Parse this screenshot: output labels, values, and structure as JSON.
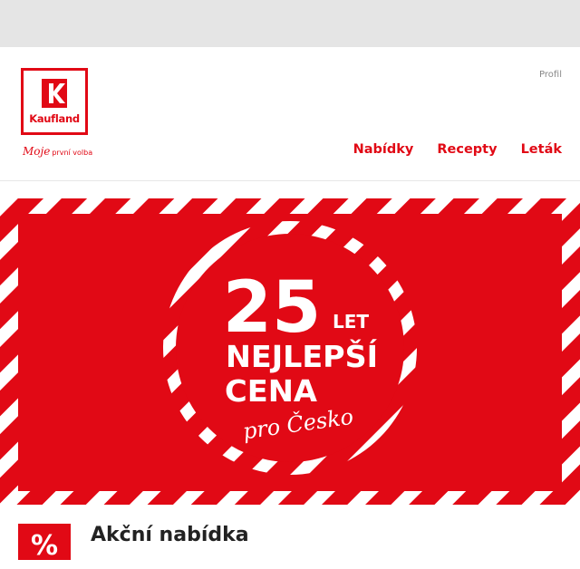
{
  "brand": {
    "name": "Kaufland",
    "slogan_script": "Moje",
    "slogan_rest": "první volba",
    "color": "#e10915"
  },
  "header": {
    "profile_label": "Profil",
    "nav": [
      {
        "label": "Nabídky"
      },
      {
        "label": "Recepty"
      },
      {
        "label": "Leták"
      }
    ]
  },
  "banner": {
    "number": "25",
    "let": "LET",
    "line1": "NEJLEPŠÍ",
    "line2": "CENA",
    "script": "pro Česko",
    "stripe_colors": [
      "#e10915",
      "#ffffff"
    ]
  },
  "section": {
    "icon": "percent-icon",
    "icon_text": "%",
    "title": "Akční nabídka"
  }
}
